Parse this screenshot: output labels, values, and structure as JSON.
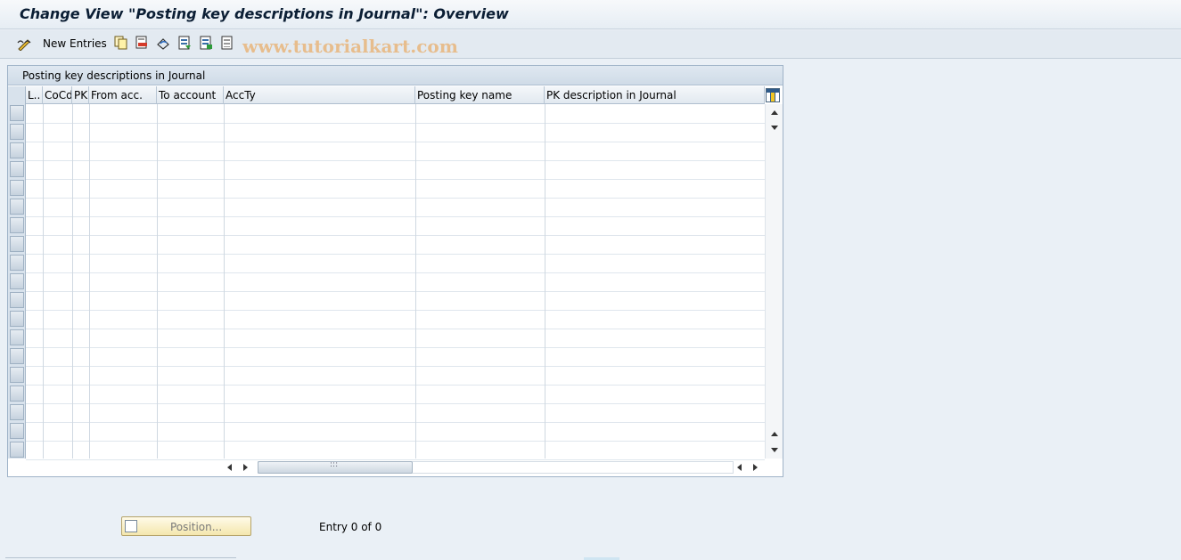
{
  "window": {
    "title": "Change View \"Posting key descriptions in Journal\": Overview"
  },
  "toolbar": {
    "new_entries_label": "New Entries",
    "icons": [
      "edit-glasses-icon",
      "copy-icon",
      "delete-icon",
      "undo-icon",
      "select-all-icon",
      "select-block-icon",
      "deselect-all-icon"
    ]
  },
  "watermark": "www.tutorialkart.com",
  "table": {
    "title": "Posting key descriptions in Journal",
    "columns": [
      "L..",
      "CoCd",
      "PK",
      "From acc.",
      "To account",
      "AccTy",
      "Posting key name",
      "PK description in Journal"
    ],
    "rows": []
  },
  "footer": {
    "position_button_label": "Position...",
    "entry_text": "Entry 0 of 0"
  }
}
